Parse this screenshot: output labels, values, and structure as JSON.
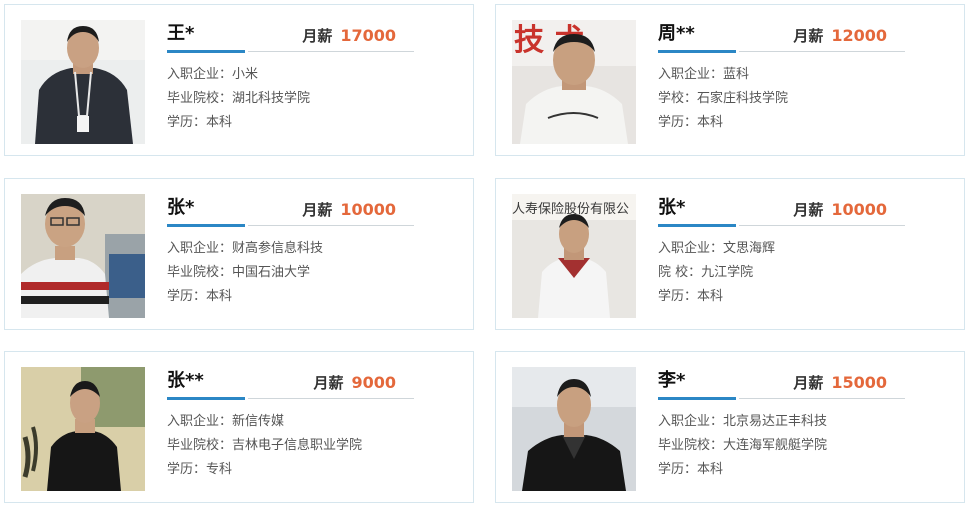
{
  "cards": [
    {
      "name": "王*",
      "salary_label": "月薪",
      "salary": "17000",
      "lines": [
        "入职企业：小米",
        "毕业院校：湖北科技学院",
        "学历：本科"
      ]
    },
    {
      "name": "周**",
      "salary_label": "月薪",
      "salary": "12000",
      "lines": [
        "入职企业：蓝科",
        "学校：石家庄科技学院",
        "学历：本科"
      ]
    },
    {
      "name": "张*",
      "salary_label": "月薪",
      "salary": "10000",
      "lines": [
        "入职企业：财高参信息科技",
        "毕业院校：中国石油大学",
        "学历：本科"
      ]
    },
    {
      "name": "张*",
      "salary_label": "月薪",
      "salary": "10000",
      "lines": [
        "入职企业：文思海辉",
        "院 校：九江学院",
        "学历：本科"
      ]
    },
    {
      "name": "张**",
      "salary_label": "月薪",
      "salary": "9000",
      "lines": [
        "入职企业：新信传媒",
        "毕业院校：吉林电子信息职业学院",
        "学历：专科"
      ]
    },
    {
      "name": "李*",
      "salary_label": "月薪",
      "salary": "15000",
      "lines": [
        "入职企业：北京易达正丰科技",
        "毕业院校：大连海军舰艇学院",
        "学历：本科"
      ]
    }
  ],
  "photo_background_text": {
    "card2": "技 术",
    "card4": "人寿保险股份有限公"
  },
  "colors": {
    "border": "#d6e6ee",
    "accent_blue": "#2b87c5",
    "salary_orange": "#e4683b",
    "text": "#555555"
  }
}
